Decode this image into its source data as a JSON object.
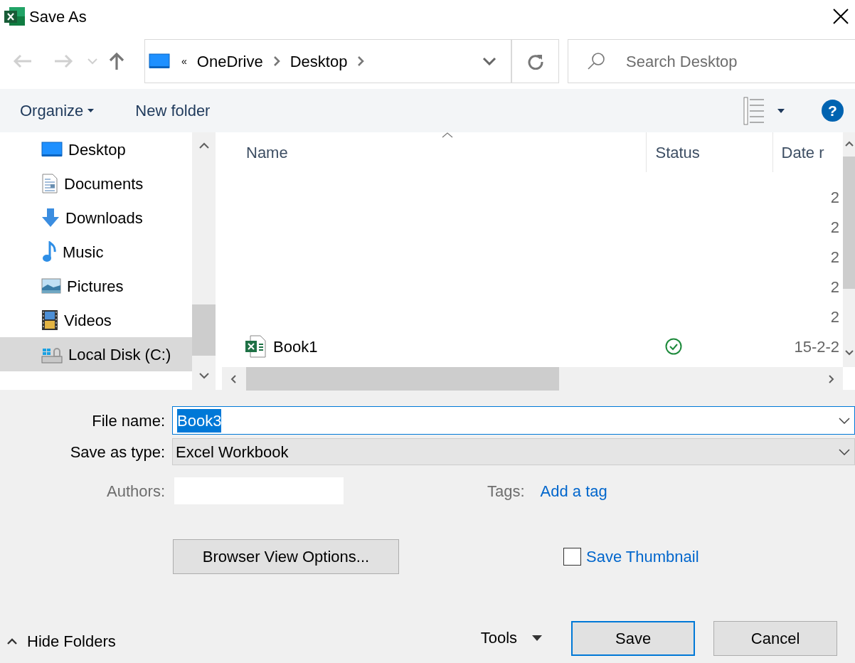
{
  "window": {
    "title": "Save As"
  },
  "address": {
    "overflow": "«",
    "segments": [
      "OneDrive",
      "Desktop"
    ]
  },
  "search": {
    "placeholder": "Search Desktop"
  },
  "toolbar": {
    "organize": "Organize",
    "new_folder": "New folder",
    "help": "?"
  },
  "sidebar": {
    "items": [
      {
        "label": "Desktop",
        "selected": false
      },
      {
        "label": "Documents",
        "selected": false
      },
      {
        "label": "Downloads",
        "selected": false
      },
      {
        "label": "Music",
        "selected": false
      },
      {
        "label": "Pictures",
        "selected": false
      },
      {
        "label": "Videos",
        "selected": false
      },
      {
        "label": "Local Disk (C:)",
        "selected": true
      }
    ]
  },
  "file_list": {
    "columns": [
      "Name",
      "Status",
      "Date r"
    ],
    "rows": [
      {
        "synced": false,
        "date": "2"
      },
      {
        "synced": false,
        "date": "2"
      },
      {
        "synced": false,
        "date": "2"
      },
      {
        "synced": false,
        "date": "2"
      },
      {
        "synced": false,
        "date": "2"
      },
      {
        "name": "Book1",
        "kind": "excel",
        "synced": true,
        "date": "15-2-2"
      }
    ]
  },
  "form": {
    "file_name": {
      "label": "File name:",
      "value": "Book3"
    },
    "save_as_type": {
      "label": "Save as type:",
      "value": "Excel Workbook"
    },
    "authors": {
      "label": "Authors:"
    },
    "tags": {
      "label": "Tags:",
      "link": "Add a tag"
    },
    "browser_view_button": "Browser View Options...",
    "save_thumbnail": {
      "label": "Save Thumbnail",
      "checked": false
    }
  },
  "footer": {
    "hide_folders": "Hide Folders",
    "tools": "Tools",
    "buttons": [
      {
        "label": "Save",
        "default": true
      },
      {
        "label": "Cancel",
        "default": false
      }
    ]
  }
}
